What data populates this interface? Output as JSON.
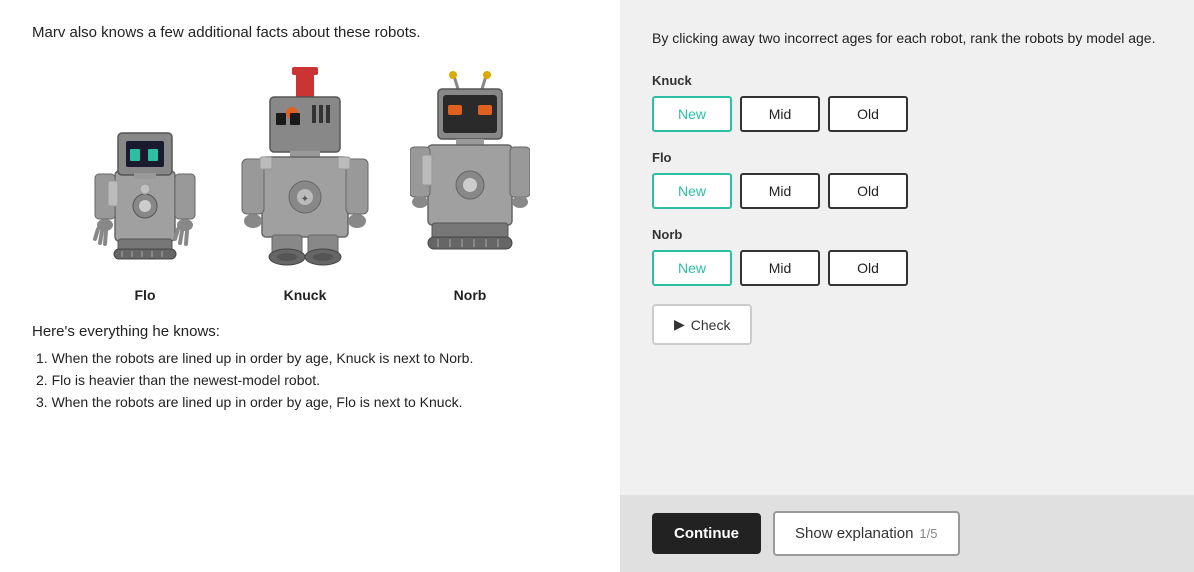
{
  "left": {
    "intro": "Marv also knows a few additional facts about these robots.",
    "facts_heading": "Here's everything he knows:",
    "facts": [
      "1. When the robots are lined up in order by age, Knuck is next to Norb.",
      "2. Flo is heavier than the newest-model robot.",
      "3. When the robots are lined up in order by age, Flo is next to Knuck."
    ],
    "robots": [
      {
        "name": "Flo",
        "size": "small"
      },
      {
        "name": "Knuck",
        "size": "medium"
      },
      {
        "name": "Norb",
        "size": "small"
      }
    ]
  },
  "right": {
    "instruction": "By clicking away two incorrect ages for each robot, rank the robots by model age.",
    "robots": [
      {
        "name": "Knuck",
        "options": [
          "New",
          "Mid",
          "Old"
        ],
        "selected": "New"
      },
      {
        "name": "Flo",
        "options": [
          "New",
          "Mid",
          "Old"
        ],
        "selected": "New"
      },
      {
        "name": "Norb",
        "options": [
          "New",
          "Mid",
          "Old"
        ],
        "selected": "New"
      }
    ],
    "check_label": "Check",
    "check_icon": "▶"
  },
  "bottom": {
    "continue_label": "Continue",
    "show_explanation_label": "Show explanation",
    "explanation_progress": "1/5"
  }
}
